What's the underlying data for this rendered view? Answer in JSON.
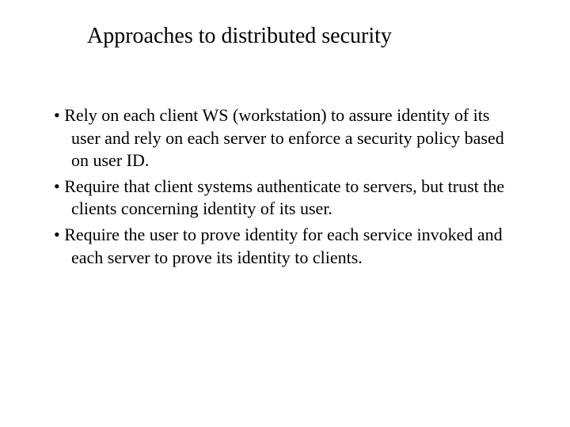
{
  "slide": {
    "title": "Approaches to distributed security",
    "bullets": [
      "Rely on each client WS (workstation) to assure identity of its user and rely on each server to enforce a security policy based on user ID.",
      "Require that client systems authenticate to servers, but trust the clients concerning identity of its user.",
      "Require the user to prove identity for each service invoked and each server to prove its identity to clients."
    ]
  }
}
